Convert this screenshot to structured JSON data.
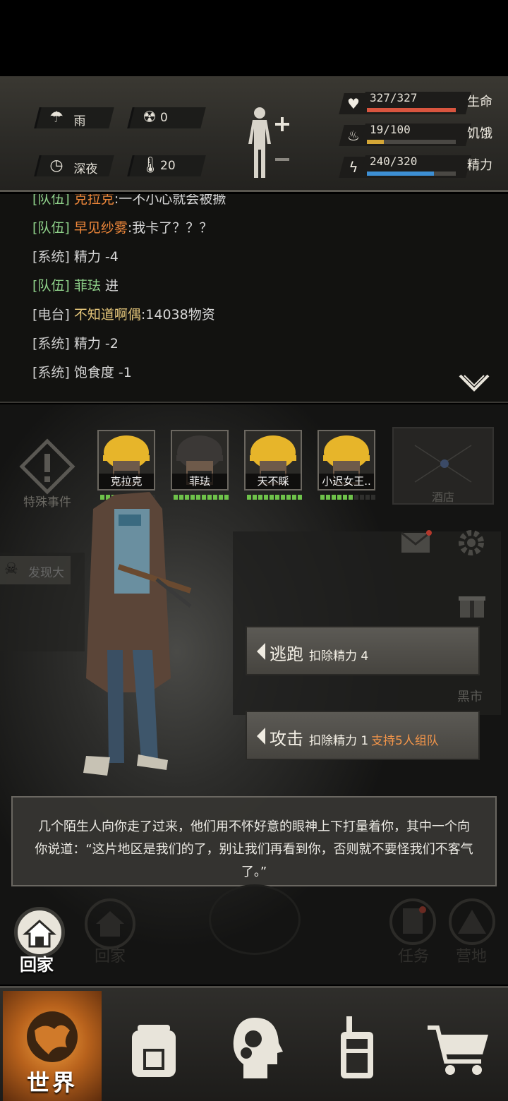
{
  "environment": {
    "weather": "雨",
    "radiation": "0",
    "time_of_day": "深夜",
    "temperature": "20"
  },
  "stats": [
    {
      "label": "生命",
      "value": "327/327",
      "fraction": 1.0,
      "color": "#d9553f",
      "icon": "heart-icon"
    },
    {
      "label": "饥饿",
      "value": "19/100",
      "fraction": 0.19,
      "color": "#d4a636",
      "icon": "stomach-icon"
    },
    {
      "label": "精力",
      "value": "240/320",
      "fraction": 0.75,
      "color": "#3d8fd4",
      "icon": "energy-icon"
    }
  ],
  "chat": [
    {
      "tag": "[队伍]",
      "name": "克拉克",
      "msg": ":一不小心就会被撅",
      "tag_type": "team",
      "name_type": "default"
    },
    {
      "tag": "[队伍]",
      "name": "早见纱雾",
      "msg": ":我卡了？？？",
      "tag_type": "team",
      "name_type": "default"
    },
    {
      "tag": "[系统]",
      "name": "",
      "msg": "精力 -4",
      "tag_type": "system",
      "name_type": "default"
    },
    {
      "tag": "[队伍]",
      "name": "菲珐",
      "msg": " 进",
      "tag_type": "team",
      "name_type": "team2"
    },
    {
      "tag": "[电台]",
      "name": "不知道啊偶",
      "msg": ":14038物资",
      "tag_type": "system",
      "name_type": "radio"
    },
    {
      "tag": "[系统]",
      "name": "",
      "msg": "精力 -2",
      "tag_type": "system",
      "name_type": "default"
    },
    {
      "tag": "[系统]",
      "name": "",
      "msg": "饱食度 -1",
      "tag_type": "system",
      "name_type": "default"
    }
  ],
  "team": [
    {
      "name": "克拉克",
      "hp_bars": 9,
      "hp_total": 10
    },
    {
      "name": "菲珐",
      "hp_bars": 10,
      "hp_total": 10
    },
    {
      "name": "天不睬",
      "hp_bars": 10,
      "hp_total": 10
    },
    {
      "name": "小迟女王..",
      "hp_bars": 6,
      "hp_total": 10
    }
  ],
  "side": {
    "special_event": "特殊事件",
    "discover": "发现大",
    "tavern": "酒店",
    "black_market": "黑市"
  },
  "actions": [
    {
      "title": "逃跑",
      "cost": "扣除精力 4",
      "extra": ""
    },
    {
      "title": "攻击",
      "cost": "扣除精力 1",
      "extra": "支持5人组队"
    }
  ],
  "event_text": "几个陌生人向你走了过来，他们用不怀好意的眼神上下打量着你，其中一个向你说道：“这片地区是我们的了，别让我们再看到你，否则就不要怪我们不客气了。”",
  "quick": {
    "home_active": "回家",
    "home_bg": "回家",
    "task": "任务",
    "camp": "营地"
  },
  "nav": {
    "world": "世界"
  }
}
